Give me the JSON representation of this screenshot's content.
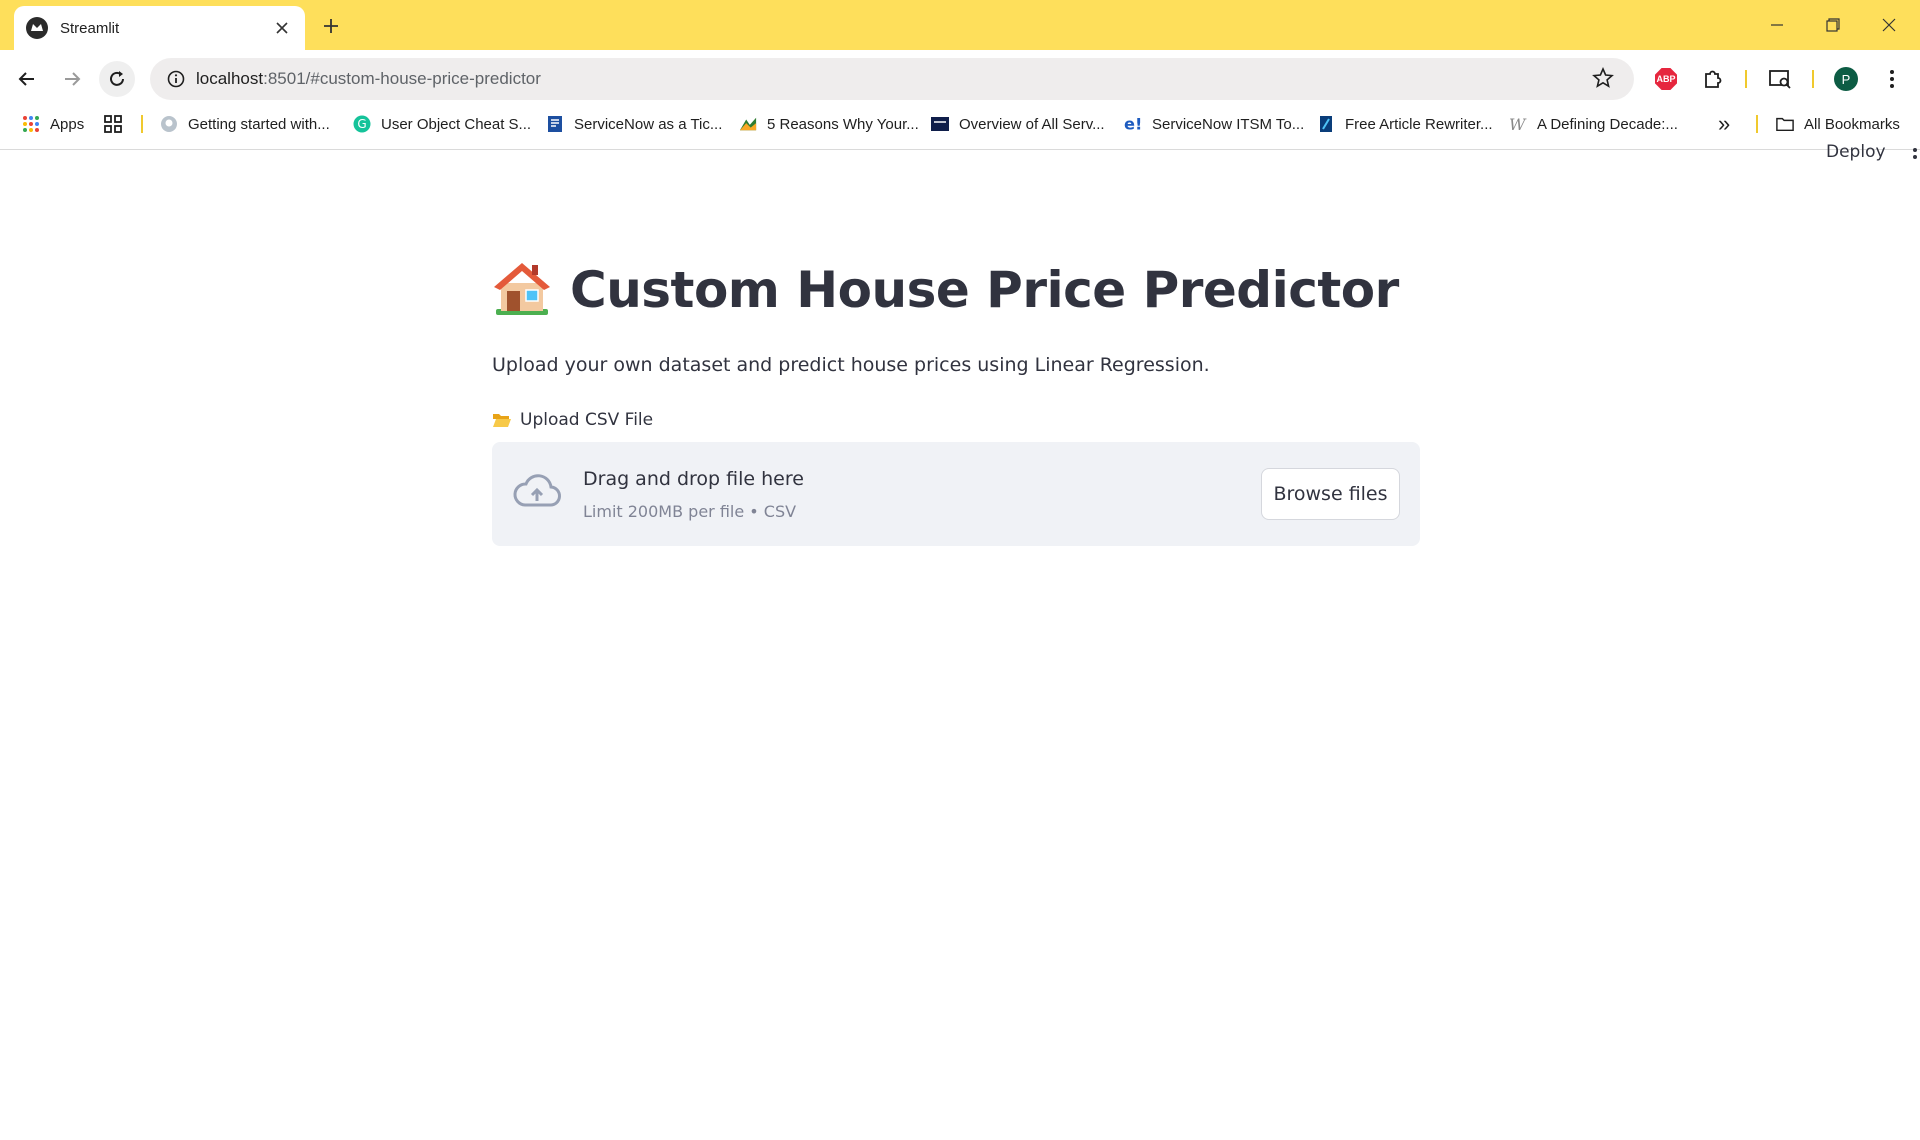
{
  "browser": {
    "tab_title": "Streamlit",
    "url_host": "localhost",
    "url_path": ":8501/#custom-house-price-predictor",
    "abp_label": "ABP",
    "profile_initial": "P"
  },
  "bookmarks": {
    "apps": "Apps",
    "items": [
      "Getting started with...",
      "User Object Cheat S...",
      "ServiceNow as a Tic...",
      "5 Reasons Why Your...",
      "Overview of All Serv...",
      "ServiceNow ITSM To...",
      "Free Article Rewriter...",
      "A Defining Decade:..."
    ],
    "overflow": "»",
    "all": "All Bookmarks"
  },
  "app": {
    "deploy_label": "Deploy",
    "title": "Custom House Price Predictor",
    "description": "Upload your own dataset and predict house prices using Linear Regression.",
    "upload_label": "Upload CSV File",
    "dropzone_title": "Drag and drop file here",
    "dropzone_limit": "Limit 200MB per file • CSV",
    "browse_label": "Browse files"
  },
  "colors": {
    "chrome_frame": "#fedf5b",
    "text_primary": "#31333f",
    "dropzone_bg": "#f0f2f6",
    "abp_red": "#e6263e",
    "profile_green": "#0d5c44"
  }
}
